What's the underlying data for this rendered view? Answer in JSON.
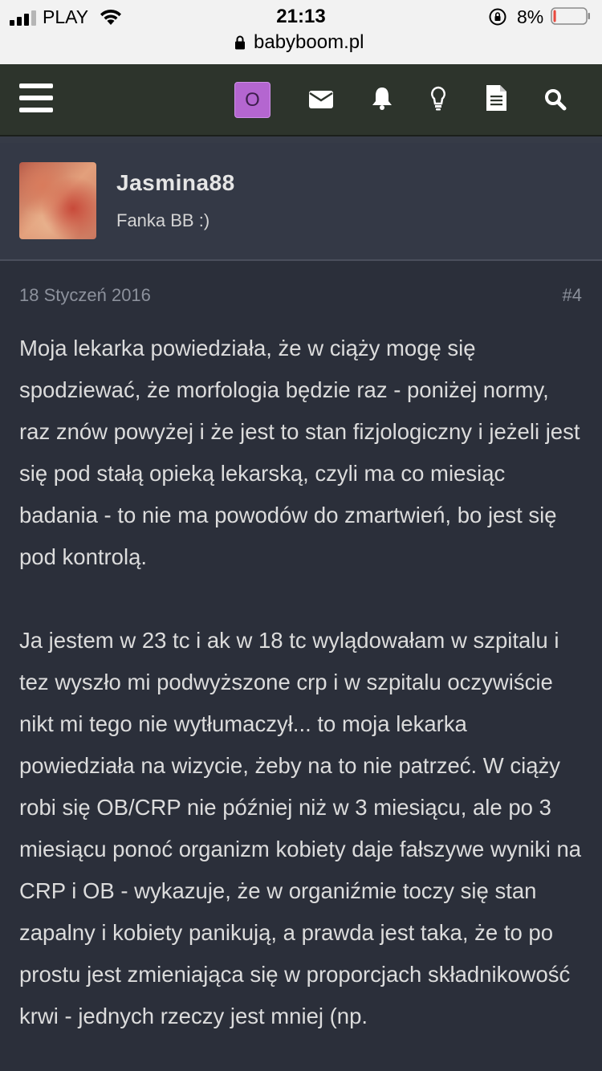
{
  "status_bar": {
    "carrier": "PLAY",
    "time": "21:13",
    "battery_percent": "8%",
    "battery_level": 0.08,
    "url": "babyboom.pl"
  },
  "navbar": {
    "user_initial": "O",
    "icons": [
      "menu-icon",
      "envelope-icon",
      "bell-icon",
      "lightbulb-icon",
      "document-icon",
      "search-icon"
    ]
  },
  "author": {
    "name": "Jasmina88",
    "rank": "Fanka BB :)"
  },
  "post": {
    "date": "18 Styczeń 2016",
    "number": "#4",
    "paragraph_1": "Moja lekarka powiedziała, że w ciąży mogę się spodziewać, że morfologia będzie raz - poniżej normy, raz znów powyżej i że jest to stan fizjologiczny i jeżeli jest się pod stałą opieką lekarską, czyli ma co miesiąc badania - to nie ma powodów do zmartwień, bo jest się pod kontrolą.",
    "paragraph_2": "Ja jestem w 23 tc i ak w 18 tc wylądowałam w szpitalu i tez wyszło mi podwyższone crp i w szpitalu oczywiście nikt mi tego nie wytłumaczył... to moja lekarka powiedziała na wizycie, żeby na to nie patrzeć. W ciąży robi się OB/CRP nie później niż w 3 miesiącu, ale po 3 miesiącu ponoć organizm kobiety daje fałszywe wyniki na CRP i OB - wykazuje, że w organiźmie toczy się stan zapalny i kobiety panikują, a prawda jest taka, że to po prostu jest zmieniająca się w proporcjach składnikowość krwi - jednych rzeczy jest mniej (np."
  },
  "colors": {
    "background": "#2b2f3a",
    "navbar": "#2d342c",
    "accent_avatar": "#b466d0",
    "battery_low": "#e84a3f"
  }
}
